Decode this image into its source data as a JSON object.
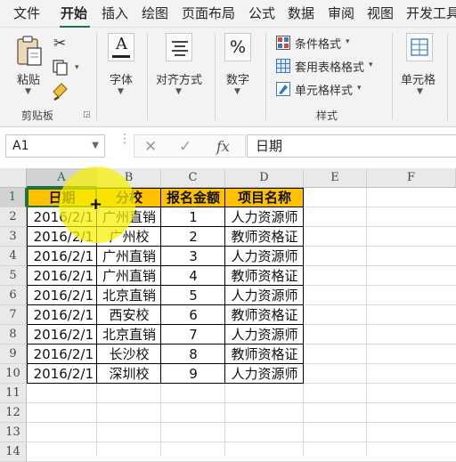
{
  "menu": {
    "tabs": [
      "文件",
      "开始",
      "插入",
      "绘图",
      "页面布局",
      "公式",
      "数据",
      "审阅",
      "视图",
      "开发工具"
    ],
    "active": "开始"
  },
  "ribbon": {
    "clipboard": {
      "paste_label": "粘贴",
      "group_label": "剪贴板"
    },
    "font": {
      "label": "字体"
    },
    "alignment": {
      "label": "对齐方式"
    },
    "number": {
      "label": "数字",
      "symbol": "%"
    },
    "styles": {
      "conditional_format": "条件格式",
      "table_format": "套用表格格式",
      "cell_styles": "单元格样式",
      "group_label": "样式"
    },
    "cells": {
      "label": "单元格"
    }
  },
  "formula_bar": {
    "name_box": "A1",
    "fx": "fx",
    "value": "日期"
  },
  "grid": {
    "columns": [
      "A",
      "B",
      "C",
      "D",
      "E",
      "F"
    ],
    "rows": [
      "1",
      "2",
      "3",
      "4",
      "5",
      "6",
      "7",
      "8",
      "9",
      "10",
      "11",
      "12",
      "13",
      "14"
    ],
    "selected_cell": "A1",
    "header": [
      "日期",
      "分校",
      "报名金额",
      "项目名称"
    ],
    "data": [
      [
        "2016/2/1",
        "广州直销",
        "1",
        "人力资源师"
      ],
      [
        "2016/2/1",
        "广州校",
        "2",
        "教师资格证"
      ],
      [
        "2016/2/1",
        "广州直销",
        "3",
        "人力资源师"
      ],
      [
        "2016/2/1",
        "广州直销",
        "4",
        "教师资格证"
      ],
      [
        "2016/2/1",
        "北京直销",
        "5",
        "人力资源师"
      ],
      [
        "2016/2/1",
        "西安校",
        "6",
        "教师资格证"
      ],
      [
        "2016/2/1",
        "北京直销",
        "7",
        "人力资源师"
      ],
      [
        "2016/2/1",
        "长沙校",
        "8",
        "教师资格证"
      ],
      [
        "2016/2/1",
        "深圳校",
        "9",
        "人力资源师"
      ]
    ]
  },
  "colors": {
    "accent": "#1e7145",
    "header_fill": "#ffc000",
    "highlight": "#f8f000"
  }
}
